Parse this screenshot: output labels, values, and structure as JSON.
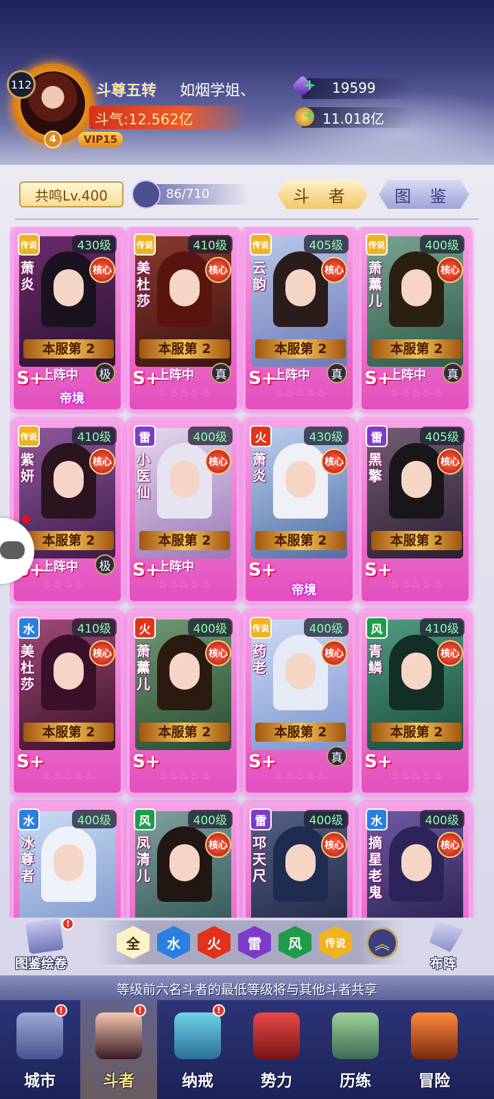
{
  "player": {
    "level": "112",
    "star": "4",
    "vip": "VIP15",
    "rank_title": "斗尊五转",
    "name": "如烟学姐、",
    "power": "斗气:12.562亿",
    "gems": "19599",
    "gold": "11.018亿"
  },
  "toolbar": {
    "resonance": "共鸣Lv.400",
    "heroes_count": "86/710",
    "tab_fighters": "斗 者",
    "tab_atlas": "图 鉴"
  },
  "heroes": [
    {
      "element": "传说",
      "level": "430级",
      "name": "萧炎",
      "core": "核心",
      "rank": "本服第 2",
      "tier": "S+",
      "deployed": "上阵中",
      "grade": "极",
      "realm": "帝境",
      "lotus": "",
      "el_color": "#f1b21f"
    },
    {
      "element": "传说",
      "level": "410级",
      "name": "美杜莎",
      "core": "核心",
      "rank": "本服第 2",
      "tier": "S+",
      "deployed": "上阵中",
      "grade": "真",
      "realm": "",
      "lotus": "♨♨♨♨♨",
      "el_color": "#f1b21f"
    },
    {
      "element": "传说",
      "level": "405级",
      "name": "云韵",
      "core": "核心",
      "rank": "本服第 2",
      "tier": "S+",
      "deployed": "上阵中",
      "grade": "真",
      "realm": "",
      "lotus": "♨♨♨♨♨",
      "el_color": "#f1b21f"
    },
    {
      "element": "传说",
      "level": "400级",
      "name": "萧薰儿",
      "core": "核心",
      "rank": "本服第 2",
      "tier": "S+",
      "deployed": "上阵中",
      "grade": "真",
      "realm": "",
      "lotus": "♨♨♨♨♨",
      "el_color": "#f1b21f"
    },
    {
      "element": "传说",
      "level": "410级",
      "name": "紫妍",
      "core": "核心",
      "rank": "本服第 2",
      "tier": "S+",
      "deployed": "上阵中",
      "grade": "极",
      "realm": "",
      "lotus": "♨♨♨♨",
      "el_color": "#f1b21f"
    },
    {
      "element": "雷",
      "level": "400级",
      "name": "小医仙",
      "core": "核心",
      "rank": "本服第 2",
      "tier": "S+",
      "deployed": "上阵中",
      "grade": "",
      "realm": "",
      "lotus": "♨♨♨♨♨",
      "el_color": "#7e3bc9"
    },
    {
      "element": "火",
      "level": "430级",
      "name": "萧炎",
      "core": "核心",
      "rank": "本服第 2",
      "tier": "S+",
      "deployed": "",
      "grade": "",
      "realm": "帝境",
      "lotus": "",
      "el_color": "#e2321c"
    },
    {
      "element": "雷",
      "level": "405级",
      "name": "黑擎",
      "core": "核心",
      "rank": "本服第 2",
      "tier": "S+",
      "deployed": "",
      "grade": "",
      "realm": "",
      "lotus": "♨♨♨♨♨",
      "el_color": "#7e3bc9"
    },
    {
      "element": "水",
      "level": "410级",
      "name": "美杜莎",
      "core": "核心",
      "rank": "本服第 2",
      "tier": "S+",
      "deployed": "",
      "grade": "",
      "realm": "",
      "lotus": "♨♨♨♨♨",
      "el_color": "#2b7fe0"
    },
    {
      "element": "火",
      "level": "400级",
      "name": "萧薰儿",
      "core": "核心",
      "rank": "本服第 2",
      "tier": "S+",
      "deployed": "",
      "grade": "",
      "realm": "",
      "lotus": "♨♨♨♨♨",
      "el_color": "#e2321c"
    },
    {
      "element": "传说",
      "level": "400级",
      "name": "药老",
      "core": "核心",
      "rank": "本服第 2",
      "tier": "S+",
      "deployed": "",
      "grade": "真",
      "realm": "",
      "lotus": "♨♨♨♨♨",
      "el_color": "#f1b21f"
    },
    {
      "element": "风",
      "level": "410级",
      "name": "青鳞",
      "core": "核心",
      "rank": "本服第 2",
      "tier": "S+",
      "deployed": "",
      "grade": "",
      "realm": "",
      "lotus": "♨♨♨♨♨",
      "el_color": "#1f9b4a"
    },
    {
      "element": "水",
      "level": "400级",
      "name": "冰尊者",
      "core": "",
      "rank": "",
      "tier": "",
      "deployed": "",
      "grade": "",
      "realm": "",
      "lotus": "",
      "el_color": "#2b7fe0"
    },
    {
      "element": "风",
      "level": "400级",
      "name": "凤清儿",
      "core": "核心",
      "rank": "",
      "tier": "",
      "deployed": "",
      "grade": "",
      "realm": "",
      "lotus": "",
      "el_color": "#1f9b4a"
    },
    {
      "element": "雷",
      "level": "400级",
      "name": "邛天尺",
      "core": "核心",
      "rank": "",
      "tier": "",
      "deployed": "",
      "grade": "",
      "realm": "",
      "lotus": "",
      "el_color": "#7e3bc9"
    },
    {
      "element": "水",
      "level": "400级",
      "name": "摘星老鬼",
      "core": "核心",
      "rank": "",
      "tier": "",
      "deployed": "",
      "grade": "",
      "realm": "",
      "lotus": "",
      "el_color": "#2b7fe0"
    }
  ],
  "filters": [
    {
      "label": "全",
      "color": "#3a2a14"
    },
    {
      "label": "水",
      "color": "#2b7fe0"
    },
    {
      "label": "火",
      "color": "#e2321c"
    },
    {
      "label": "雷",
      "color": "#7e3bc9"
    },
    {
      "label": "风",
      "color": "#1f9b4a"
    },
    {
      "label": "传说",
      "color": "#f1b21f"
    }
  ],
  "side": {
    "atlas_scroll": "图鉴绘卷",
    "formation": "布阵",
    "badge": "!"
  },
  "hint": "等级前六名斗者的最低等级将与其他斗者共享",
  "nav": [
    {
      "label": "城市",
      "badge": "!"
    },
    {
      "label": "斗者",
      "badge": "!"
    },
    {
      "label": "纳戒",
      "badge": "!"
    },
    {
      "label": "势力",
      "badge": ""
    },
    {
      "label": "历练",
      "badge": ""
    },
    {
      "label": "冒险",
      "badge": ""
    }
  ]
}
